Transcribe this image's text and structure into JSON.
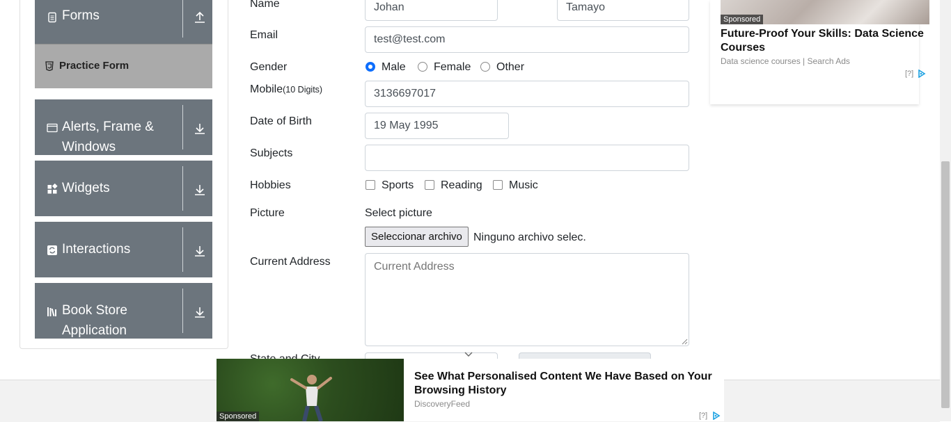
{
  "sidebar": {
    "groups": [
      {
        "label": "Forms",
        "icon": "document-icon",
        "arrow": "arrow-up-icon"
      },
      {
        "label": "Alerts, Frame & Windows",
        "icon": "window-icon",
        "arrow": "arrow-down-icon"
      },
      {
        "label": "Widgets",
        "icon": "widgets-icon",
        "arrow": "arrow-down-icon"
      },
      {
        "label": "Interactions",
        "icon": "interactions-icon",
        "arrow": "arrow-down-icon"
      },
      {
        "label": "Book Store Application",
        "icon": "books-icon",
        "arrow": "arrow-down-icon"
      }
    ],
    "active_item": {
      "label": "Practice Form",
      "icon": "html5-icon"
    }
  },
  "form": {
    "name": {
      "label": "Name",
      "first": "Johan",
      "last": "Tamayo"
    },
    "email": {
      "label": "Email",
      "value": "test@test.com"
    },
    "gender": {
      "label": "Gender",
      "options": [
        "Male",
        "Female",
        "Other"
      ],
      "selected": "Male"
    },
    "mobile": {
      "label": "Mobile",
      "hint": "(10 Digits)",
      "value": "3136697017"
    },
    "dob": {
      "label": "Date of Birth",
      "value": "19 May 1995"
    },
    "subjects": {
      "label": "Subjects",
      "value": ""
    },
    "hobbies": {
      "label": "Hobbies",
      "options": [
        "Sports",
        "Reading",
        "Music"
      ]
    },
    "picture": {
      "label": "Picture",
      "prompt": "Select picture",
      "button": "Seleccionar archivo",
      "status": "Ninguno archivo selec."
    },
    "address": {
      "label": "Current Address",
      "placeholder": "Current Address"
    },
    "state_city": {
      "label": "State and City"
    }
  },
  "ads": {
    "right": {
      "tag": "Sponsored",
      "title": "Future-Proof Your Skills: Data Science Courses",
      "source": "Data science courses | Search Ads",
      "q": "[?]"
    },
    "bottom": {
      "tag": "Sponsored",
      "title": "See What Personalised Content We Have Based on Your Browsing History",
      "source": "DiscoveryFeed",
      "q": "[?]"
    }
  },
  "colors": {
    "sidebar_bg": "#6c757d",
    "active_bg": "#aaaaaa",
    "accent": "#0d6efd",
    "adchoices": "#1ba1e2"
  }
}
